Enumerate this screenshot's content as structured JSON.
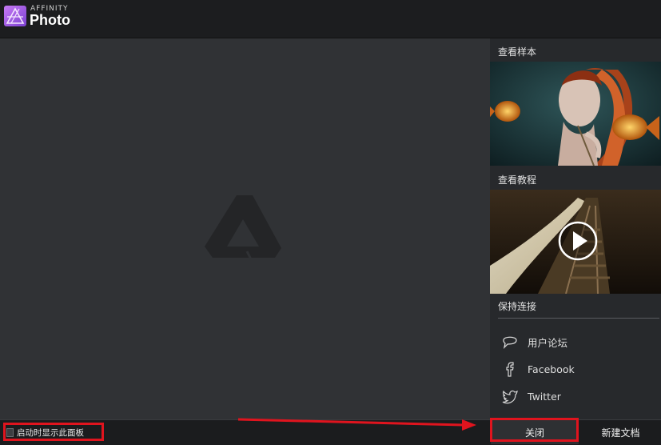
{
  "header": {
    "brand_small": "AFFINITY",
    "brand_name": "Photo"
  },
  "sidebar": {
    "samples_title": "查看样本",
    "tutorials_title": "查看教程",
    "connect_title": "保持连接",
    "links": [
      {
        "label": "用户论坛",
        "icon": "chat-bubble-icon"
      },
      {
        "label": "Facebook",
        "icon": "facebook-icon"
      },
      {
        "label": "Twitter",
        "icon": "twitter-icon"
      }
    ]
  },
  "footer": {
    "startup_label": "启动时显示此面板",
    "close_label": "关闭",
    "new_doc_label": "新建文档"
  },
  "colors": {
    "annotation_red": "#e0141e",
    "brand_purple": "#b05cf0"
  }
}
